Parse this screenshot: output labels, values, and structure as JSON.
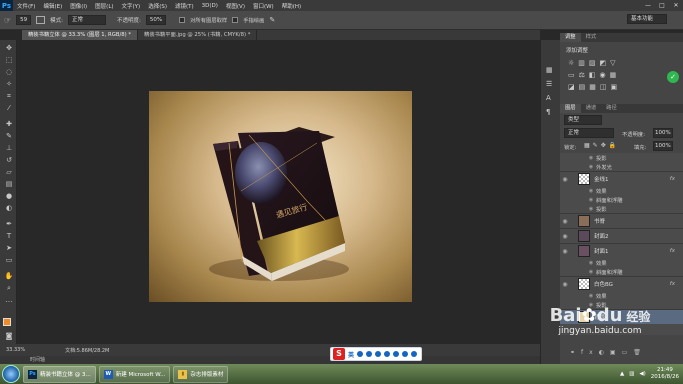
{
  "app": {
    "logo": "Ps"
  },
  "menu": [
    "文件(F)",
    "编辑(E)",
    "图像(I)",
    "图层(L)",
    "文字(Y)",
    "选择(S)",
    "滤镜(T)",
    "3D(D)",
    "视图(V)",
    "窗口(W)",
    "帮助(H)"
  ],
  "window_controls": {
    "minimize": "—",
    "maximize": "□",
    "close": "✕"
  },
  "options": {
    "size": "59",
    "mode_label": "模式:",
    "mode_value": "正常",
    "opacity_label": "不透明度:",
    "opacity_value": "50%",
    "sample_all_label": "对所有图层取样",
    "auto_erase_label": "手指绘画",
    "workspace": "基本功能"
  },
  "tabs": [
    {
      "label": "精装书籍立体 @ 33.3% (图层 1, RGB/8) *",
      "active": true
    },
    {
      "label": "精装书籍平面.jpg @ 25% (书籍, CMYK/8) *",
      "active": false
    }
  ],
  "status": {
    "zoom": "33.33%",
    "doc": "文档:5.86M/28.2M"
  },
  "timeline": {
    "label": "时间轴"
  },
  "ime": {
    "logo": "S",
    "lang": "英"
  },
  "right_panel": {
    "top_tabs": [
      "调整",
      "样式"
    ],
    "adjust_title": "添加调整",
    "layer_tabs": [
      "图层",
      "通道",
      "路径"
    ],
    "kind_filter": "类型",
    "blend_mode": "正常",
    "opacity_label": "不透明度:",
    "opacity_value": "100%",
    "lock_label": "锁定:",
    "fill_label": "填充:",
    "fill_value": "100%",
    "rows": [
      {
        "kind": "sub",
        "label": "投影"
      },
      {
        "kind": "sub",
        "label": "外发光"
      },
      {
        "kind": "layer",
        "label": "金线1",
        "fx": "fx"
      },
      {
        "kind": "sub",
        "label": "效果"
      },
      {
        "kind": "sub",
        "label": "斜面和浮雕"
      },
      {
        "kind": "sub",
        "label": "投影"
      },
      {
        "kind": "layer",
        "label": "书脊",
        "fx": ""
      },
      {
        "kind": "layer",
        "label": "封面2",
        "fx": ""
      },
      {
        "kind": "layer",
        "label": "封面1",
        "fx": "fx"
      },
      {
        "kind": "sub",
        "label": "效果"
      },
      {
        "kind": "sub",
        "label": "斜面和浮雕"
      },
      {
        "kind": "layer",
        "label": "白色BG",
        "fx": "fx"
      },
      {
        "kind": "sub",
        "label": "效果"
      },
      {
        "kind": "sub",
        "label": "投影"
      },
      {
        "kind": "layer",
        "label": "背景",
        "fx": ""
      }
    ]
  },
  "book": {
    "title": "遇见旅行"
  },
  "taskbar": {
    "items": [
      {
        "label": "精装书籍立体 @ 3...",
        "icon": "Ps"
      },
      {
        "label": "新建 Microsoft W...",
        "icon": "W"
      },
      {
        "label": "杂志排版素材",
        "icon": "▮"
      }
    ],
    "time": "21:49",
    "date": "2016/8/26"
  },
  "watermark": {
    "brand": "Bai",
    "paw": "du",
    "suffix": "经验",
    "url": "jingyan.baidu.com"
  }
}
